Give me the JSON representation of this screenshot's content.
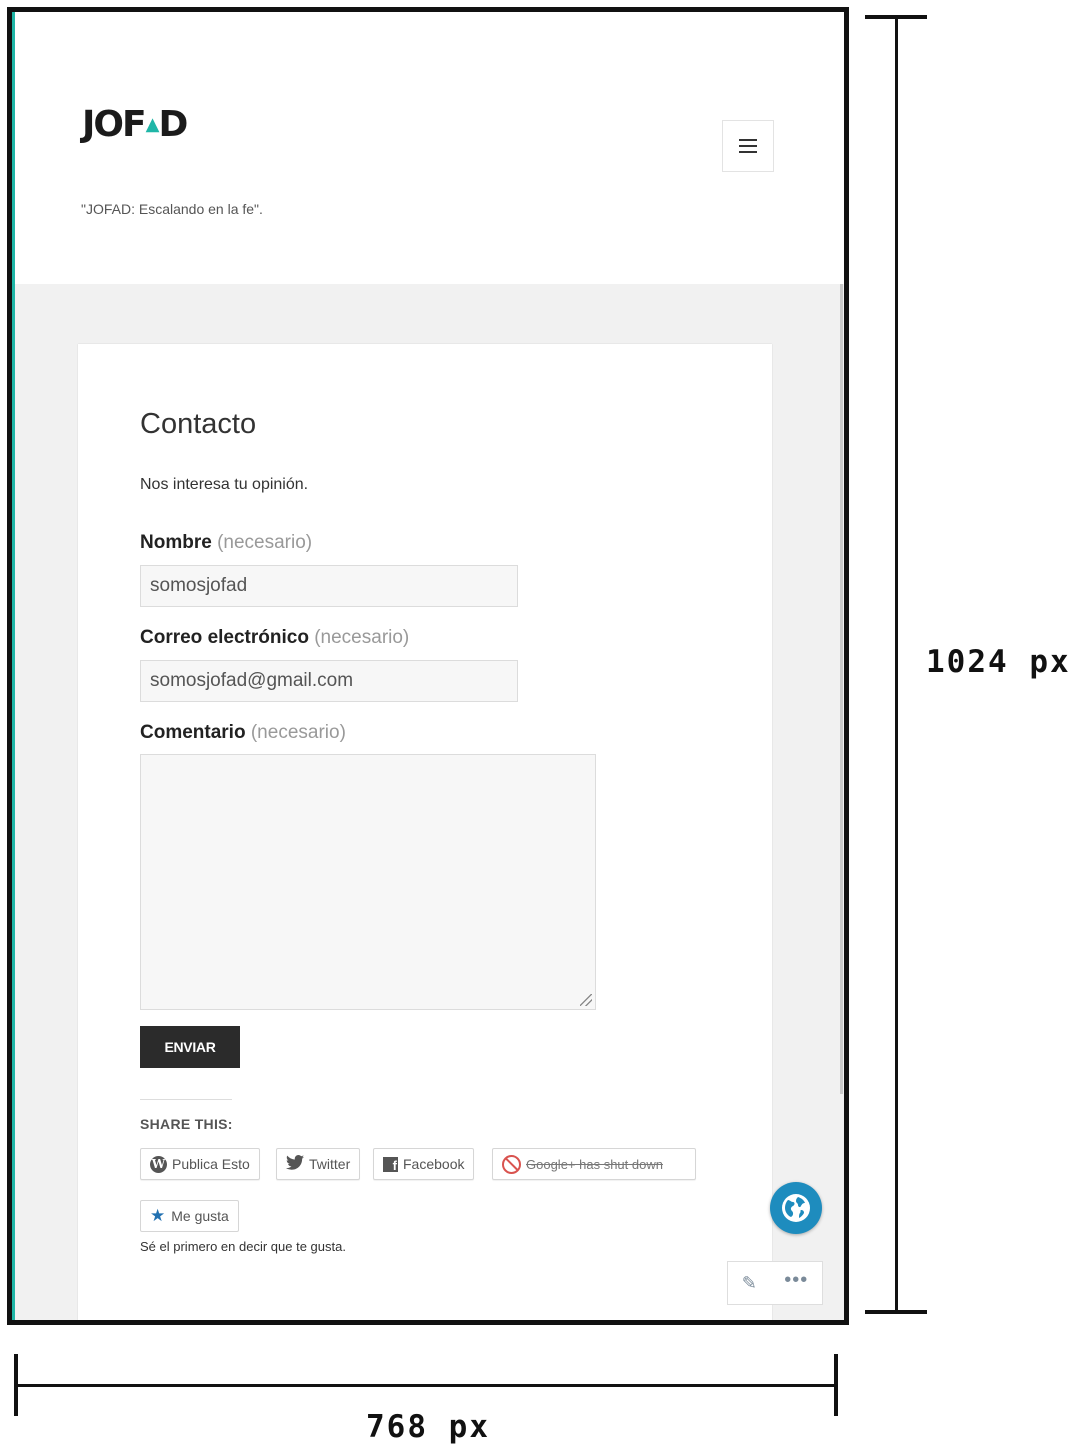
{
  "site": {
    "logo_prefix": "JOF",
    "logo_suffix": "D",
    "tagline": "\"JOFAD: Escalando en la fe\"."
  },
  "page": {
    "title": "Contacto",
    "intro": "Nos interesa tu opinión."
  },
  "form": {
    "name_label": "Nombre",
    "name_required": "(necesario)",
    "name_value": "somosjofad",
    "email_label": "Correo electrónico",
    "email_required": "(necesario)",
    "email_value": "somosjofad@gmail.com",
    "comment_label": "Comentario",
    "comment_required": "(necesario)",
    "submit_label": "ENVIAR"
  },
  "share": {
    "title": "SHARE THIS:",
    "buttons": [
      {
        "label": "Publica Esto",
        "icon": "wordpress-icon"
      },
      {
        "label": "Twitter",
        "icon": "twitter-icon"
      },
      {
        "label": "Facebook",
        "icon": "facebook-icon"
      },
      {
        "label": "Google+ has shut down",
        "icon": "prohibited-icon"
      }
    ]
  },
  "likes": {
    "button_label": "Me gusta",
    "note": "Sé el primero en decir que te gusta."
  },
  "annotations": {
    "height_label": "1024 px",
    "width_label": "768 px"
  },
  "colors": {
    "accent": "#1fb6a7",
    "button_dark": "#2b2b2b",
    "globe_blue": "#1e8cbe",
    "page_bg": "#f1f1f1"
  }
}
